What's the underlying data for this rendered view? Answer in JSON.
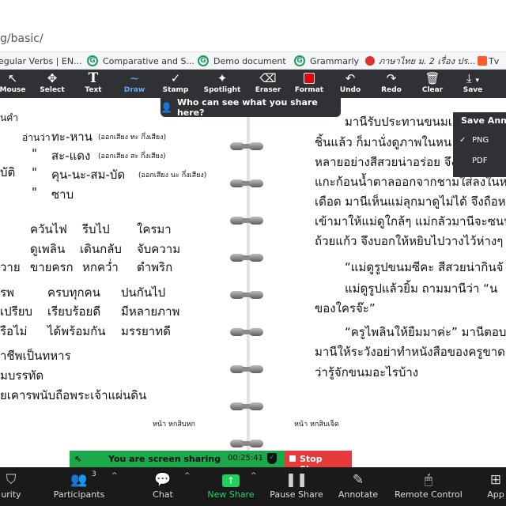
{
  "browser": {
    "url": "g/basic/",
    "bookmarks": [
      {
        "label": "egular Verbs | EN..."
      },
      {
        "label": "Comparative and S..."
      },
      {
        "label": "Demo document"
      },
      {
        "label": "Grammarly"
      },
      {
        "label": "ภาษาไทย ม. 2 เรื่อง ปร..."
      },
      {
        "label": "Tv"
      }
    ]
  },
  "annotation_toolbar": {
    "tools": [
      {
        "label": "Mouse",
        "icon": "mouse-pointer-icon"
      },
      {
        "label": "Select",
        "icon": "move-icon"
      },
      {
        "label": "Text",
        "icon": "text-icon"
      },
      {
        "label": "Draw",
        "icon": "draw-wave-icon"
      },
      {
        "label": "Stamp",
        "icon": "checkmark-icon"
      },
      {
        "label": "Spotlight",
        "icon": "spotlight-icon"
      },
      {
        "label": "Eraser",
        "icon": "eraser-icon"
      },
      {
        "label": "Format",
        "icon": "color-swatch-icon"
      },
      {
        "label": "Undo",
        "icon": "undo-icon"
      },
      {
        "label": "Redo",
        "icon": "redo-icon"
      },
      {
        "label": "Clear",
        "icon": "trash-icon"
      },
      {
        "label": "Save",
        "icon": "save-download-icon"
      }
    ],
    "format_color": "#e8000b",
    "who_can_see": "Who can see what you share here?"
  },
  "save_menu": {
    "title": "Save Anno",
    "options": [
      {
        "label": "PNG",
        "checked": "✓"
      },
      {
        "label": "PDF",
        "checked": ""
      }
    ]
  },
  "notebook": {
    "left": {
      "top_fragment": "นคำ",
      "read_as_label": "อ่านว่า",
      "rows": [
        {
          "prefix": "",
          "word": "ทะ-หาน",
          "note": "(ออกเสียง ทะ กึ่งเสียง)"
        },
        {
          "prefix": "\"",
          "word": "สะ-แดง",
          "note": "(ออกเสียง สะ กึ่งเสียง)"
        },
        {
          "prefix": "\"",
          "word": "คุน-นะ-สม-บัด",
          "note": "(ออกเสียง นะ กึ่งเสียง)"
        },
        {
          "prefix": "\"",
          "word": "ซาบ",
          "note": ""
        }
      ],
      "row_lead": [
        "",
        "",
        "บัติ",
        ""
      ],
      "grid": [
        [
          "ควันไฟ",
          "รีบไป",
          "ใครมา"
        ],
        [
          "ดูเพลิน",
          "เดินกลับ",
          "จับความ"
        ],
        [
          "ขายครก",
          "หกคว่ำ",
          "ตำพริก"
        ],
        [
          "ครบทุกคน",
          "ปนกันไป",
          ""
        ],
        [
          "เรียบร้อยดี",
          "มีหลายภาพ",
          ""
        ],
        [
          "ได้พร้อมกัน",
          "มรรยาทดี",
          ""
        ]
      ],
      "grid_lead": [
        "",
        "",
        "วาย",
        "รพ",
        "เปรียบ",
        "รือไม่"
      ],
      "tail": [
        "าชีพเป็นทหาร",
        "มบรรทัด",
        "ยเคารพนับถือพระเจ้าแผ่นดิน"
      ],
      "page_number": "หน้า หกสิบหก"
    },
    "right": {
      "lines": [
        "มานีรับประทานขนมเ",
        "ชิ้นแล้ว  ก็มานั่งดูภาพในหน",
        "หลายอย่างสีสวยน่าอร่อย  จึงชี้",
        "แกะก้อนน้ำตาลออกจากชามใส่ลงในหม้อ",
        "เดือด  มานีเห็นแม่ลุกมาดูไม่ได้  จึงถือหนั",
        "เข้ามาให้แม่ดูใกล้ๆ  แม่กลัวมานีจะซนน",
        "ถ้วยแก้ว  จึงบอกให้หยิบไปวางไว้ห่างๆ",
        "“แม่ดูรูปขนมซีคะ  สีสวยน่ากินจั",
        "แม่ดูรูปแล้วยิ้ม  ถามมานีว่า  “น",
        "ของใครจ๊ะ”",
        "“ครูไพลินให้ยืมมาค่ะ”  มานีตอบ  แ",
        "มานีให้ระวังอย่าทำหนังสือของครูขาด  แล",
        "ว่ารู้จักขนมอะไรบ้าง"
      ],
      "page_number": "หน้า หกสิบเจ็ด"
    }
  },
  "share_banner": {
    "message": "You are screen sharing",
    "time": "00:25:41",
    "stop_label": "Stop Share"
  },
  "zoom_bar": {
    "items": [
      {
        "label": "urity",
        "icon": "shield-icon"
      },
      {
        "label": "Participants",
        "icon": "participants-icon",
        "count": "3"
      },
      {
        "label": "Chat",
        "icon": "chat-icon"
      },
      {
        "label": "New Share",
        "icon": "share-up-arrow-icon"
      },
      {
        "label": "Pause Share",
        "icon": "pause-icon"
      },
      {
        "label": "Annotate",
        "icon": "pencil-icon"
      },
      {
        "label": "Remote Control",
        "icon": "mouse-icon"
      },
      {
        "label": "App",
        "icon": "apps-icon"
      }
    ],
    "accent": "#23d26a"
  }
}
